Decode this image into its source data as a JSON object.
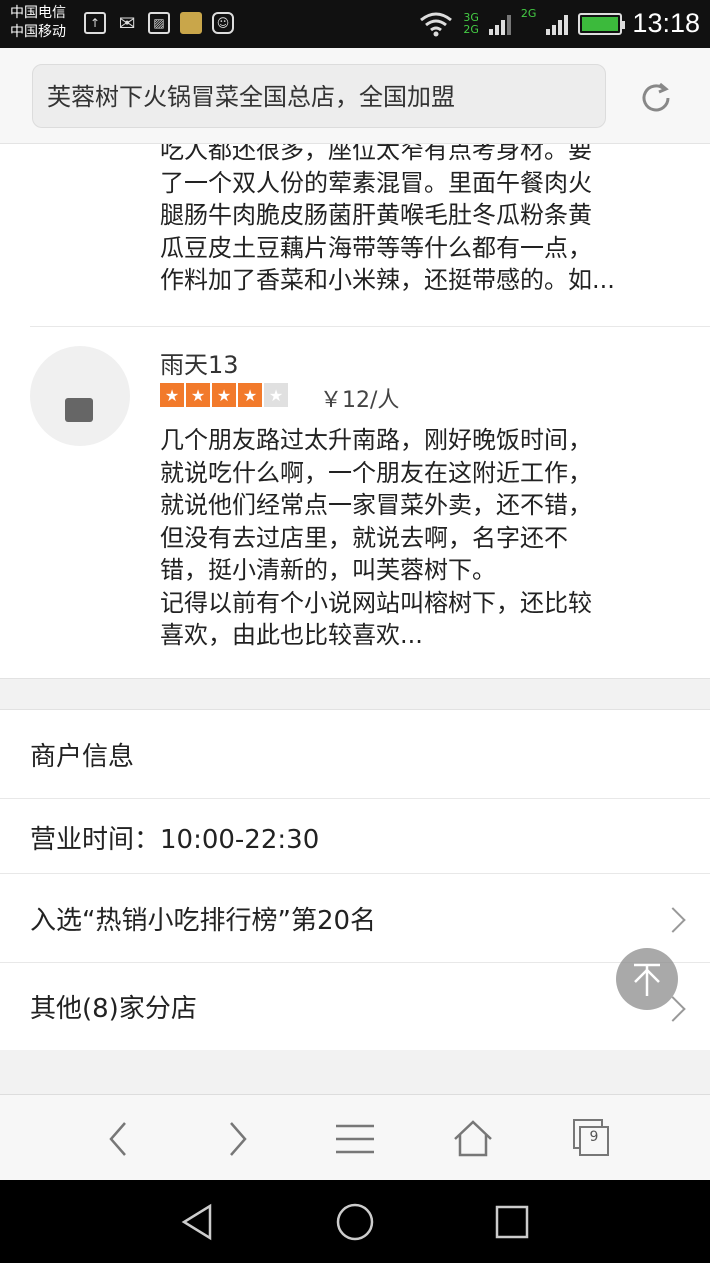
{
  "status_bar": {
    "carrier1": "中国电信",
    "carrier2": "中国移动",
    "net_3g": "3G",
    "net_2g_a": "2G",
    "net_2g_b": "2G",
    "time": "13:18"
  },
  "url_bar": {
    "title": "芙蓉树下火锅冒菜全国总店，全国加盟",
    "reload_icon": "reload-icon"
  },
  "reviews": {
    "previous": {
      "lines": [
        "吃人都还很多，座位太窄有点考身材。要",
        "了一个双人份的荤素混冒。里面午餐肉火",
        "腿肠牛肉脆皮肠菌肝黄喉毛肚冬瓜粉条黄",
        "瓜豆皮土豆藕片海带等等什么都有一点，",
        "作料加了香菜和小米辣，还挺带感的。如..."
      ]
    },
    "current": {
      "username": "雨天13",
      "rating": 4,
      "rating_max": 5,
      "price": "￥12/人",
      "lines": [
        "几个朋友路过太升南路，刚好晚饭时间，",
        "就说吃什么啊，一个朋友在这附近工作，",
        "就说他们经常点一家冒菜外卖，还不错，",
        "但没有去过店里，就说去啊，名字还不",
        "错，挺小清新的，叫芙蓉树下。",
        "记得以前有个小说网站叫榕树下，还比较",
        "喜欢，由此也比较喜欢..."
      ]
    }
  },
  "merchant_info": {
    "heading": "商户信息",
    "hours": "营业时间：10:00-22:30",
    "ranking": "入选“热销小吃排行榜”第20名",
    "branches": "其他(8)家分店"
  },
  "toolbar": {
    "tabs_count": "9"
  },
  "colors": {
    "star_on": "#f27a2b",
    "star_off": "#e0e0e0",
    "status_bar_bg": "#111111"
  }
}
